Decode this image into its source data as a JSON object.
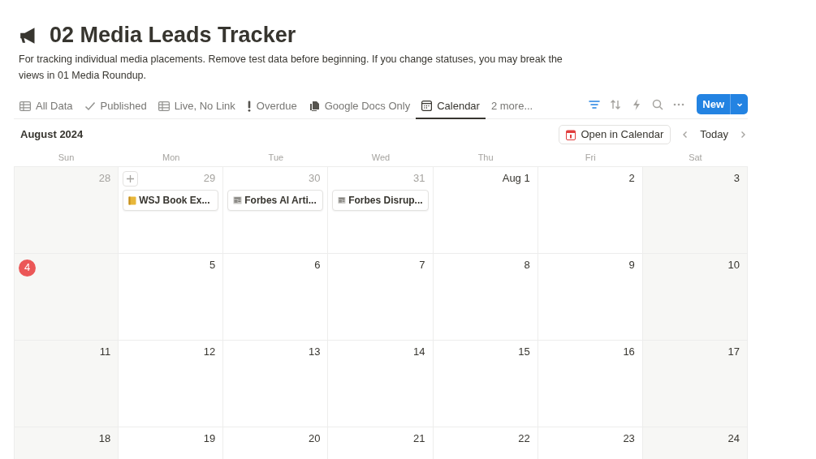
{
  "page": {
    "title": "02 Media Leads Tracker",
    "description": "For tracking individual media placements. Remove test data before beginning. If you change statuses, you may break the views in 01 Media Roundup."
  },
  "tabs": [
    {
      "label": "All Data",
      "kind": "table",
      "selected": false
    },
    {
      "label": "Published",
      "kind": "check",
      "selected": false
    },
    {
      "label": "Live, No Link",
      "kind": "table",
      "selected": false
    },
    {
      "label": "Overdue",
      "kind": "exclamation",
      "selected": false
    },
    {
      "label": "Google Docs Only",
      "kind": "docs",
      "selected": false
    },
    {
      "label": "Calendar",
      "kind": "calendar",
      "selected": true
    },
    {
      "label": "2 more...",
      "kind": "plain",
      "selected": false
    }
  ],
  "toolbar": {
    "filter_active": true,
    "new_button": "New"
  },
  "calendar": {
    "month": "August 2024",
    "open_button": "Open in Calendar",
    "today_button": "Today",
    "weekdays": [
      "Sun",
      "Mon",
      "Tue",
      "Wed",
      "Thu",
      "Fri",
      "Sat"
    ],
    "weeks": [
      [
        {
          "label": "28",
          "in_month": false,
          "today": false,
          "add_button": false
        },
        {
          "label": "29",
          "in_month": false,
          "today": false,
          "add_button": true,
          "events": [
            {
              "title": "WSJ Book Ex...",
              "kind": "note"
            }
          ]
        },
        {
          "label": "30",
          "in_month": false,
          "today": false,
          "add_button": false,
          "events": [
            {
              "title": "Forbes AI Arti...",
              "kind": "newspaper"
            }
          ]
        },
        {
          "label": "31",
          "in_month": false,
          "today": false,
          "add_button": false,
          "events": [
            {
              "title": "Forbes Disrup...",
              "kind": "newspaper"
            }
          ]
        },
        {
          "label": "Aug 1",
          "in_month": true,
          "today": false,
          "add_button": false
        },
        {
          "label": "2",
          "in_month": true,
          "today": false,
          "add_button": false
        },
        {
          "label": "3",
          "in_month": true,
          "today": false,
          "add_button": false
        }
      ],
      [
        {
          "label": "4",
          "in_month": true,
          "today": true,
          "add_button": false
        },
        {
          "label": "5",
          "in_month": true,
          "today": false,
          "add_button": false
        },
        {
          "label": "6",
          "in_month": true,
          "today": false,
          "add_button": false
        },
        {
          "label": "7",
          "in_month": true,
          "today": false,
          "add_button": false
        },
        {
          "label": "8",
          "in_month": true,
          "today": false,
          "add_button": false
        },
        {
          "label": "9",
          "in_month": true,
          "today": false,
          "add_button": false
        },
        {
          "label": "10",
          "in_month": true,
          "today": false,
          "add_button": false
        }
      ],
      [
        {
          "label": "11",
          "in_month": true,
          "today": false,
          "add_button": false
        },
        {
          "label": "12",
          "in_month": true,
          "today": false,
          "add_button": false
        },
        {
          "label": "13",
          "in_month": true,
          "today": false,
          "add_button": false
        },
        {
          "label": "14",
          "in_month": true,
          "today": false,
          "add_button": false
        },
        {
          "label": "15",
          "in_month": true,
          "today": false,
          "add_button": false
        },
        {
          "label": "16",
          "in_month": true,
          "today": false,
          "add_button": false
        },
        {
          "label": "17",
          "in_month": true,
          "today": false,
          "add_button": false
        }
      ],
      [
        {
          "label": "18",
          "in_month": true,
          "today": false,
          "add_button": false
        },
        {
          "label": "19",
          "in_month": true,
          "today": false,
          "add_button": false
        },
        {
          "label": "20",
          "in_month": true,
          "today": false,
          "add_button": false
        },
        {
          "label": "21",
          "in_month": true,
          "today": false,
          "add_button": false
        },
        {
          "label": "22",
          "in_month": true,
          "today": false,
          "add_button": false
        },
        {
          "label": "23",
          "in_month": true,
          "today": false,
          "add_button": false
        },
        {
          "label": "24",
          "in_month": true,
          "today": false,
          "add_button": false
        }
      ]
    ]
  }
}
